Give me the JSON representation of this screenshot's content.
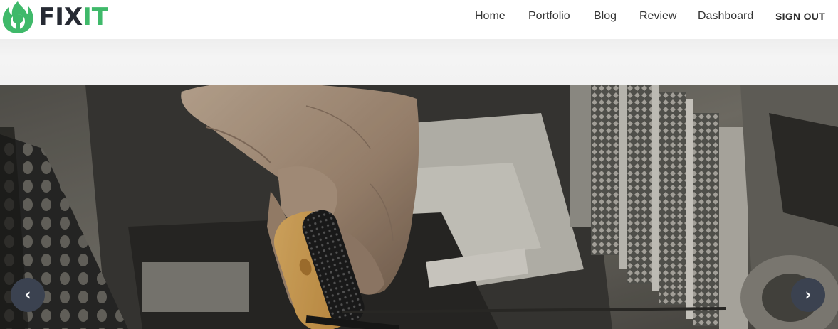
{
  "brand": {
    "name_part1": "FIX",
    "name_part2": "IT",
    "logo_icon": "flame-wrench-icon",
    "colors": {
      "dark": "#262a33",
      "accent": "#3fb96a"
    }
  },
  "nav": {
    "items": [
      {
        "label": "Home"
      },
      {
        "label": "Portfolio"
      },
      {
        "label": "Blog"
      },
      {
        "label": "Review"
      },
      {
        "label": "Dashboard"
      }
    ],
    "signout_label": "SIGN OUT"
  },
  "carousel": {
    "prev_label": "‹",
    "next_label": "›",
    "prev_icon": "chevron-left-icon",
    "next_icon": "chevron-right-icon",
    "slide_image": "hand-with-screwdriver-repairing-computer-case",
    "button_color": "#3b4250"
  }
}
